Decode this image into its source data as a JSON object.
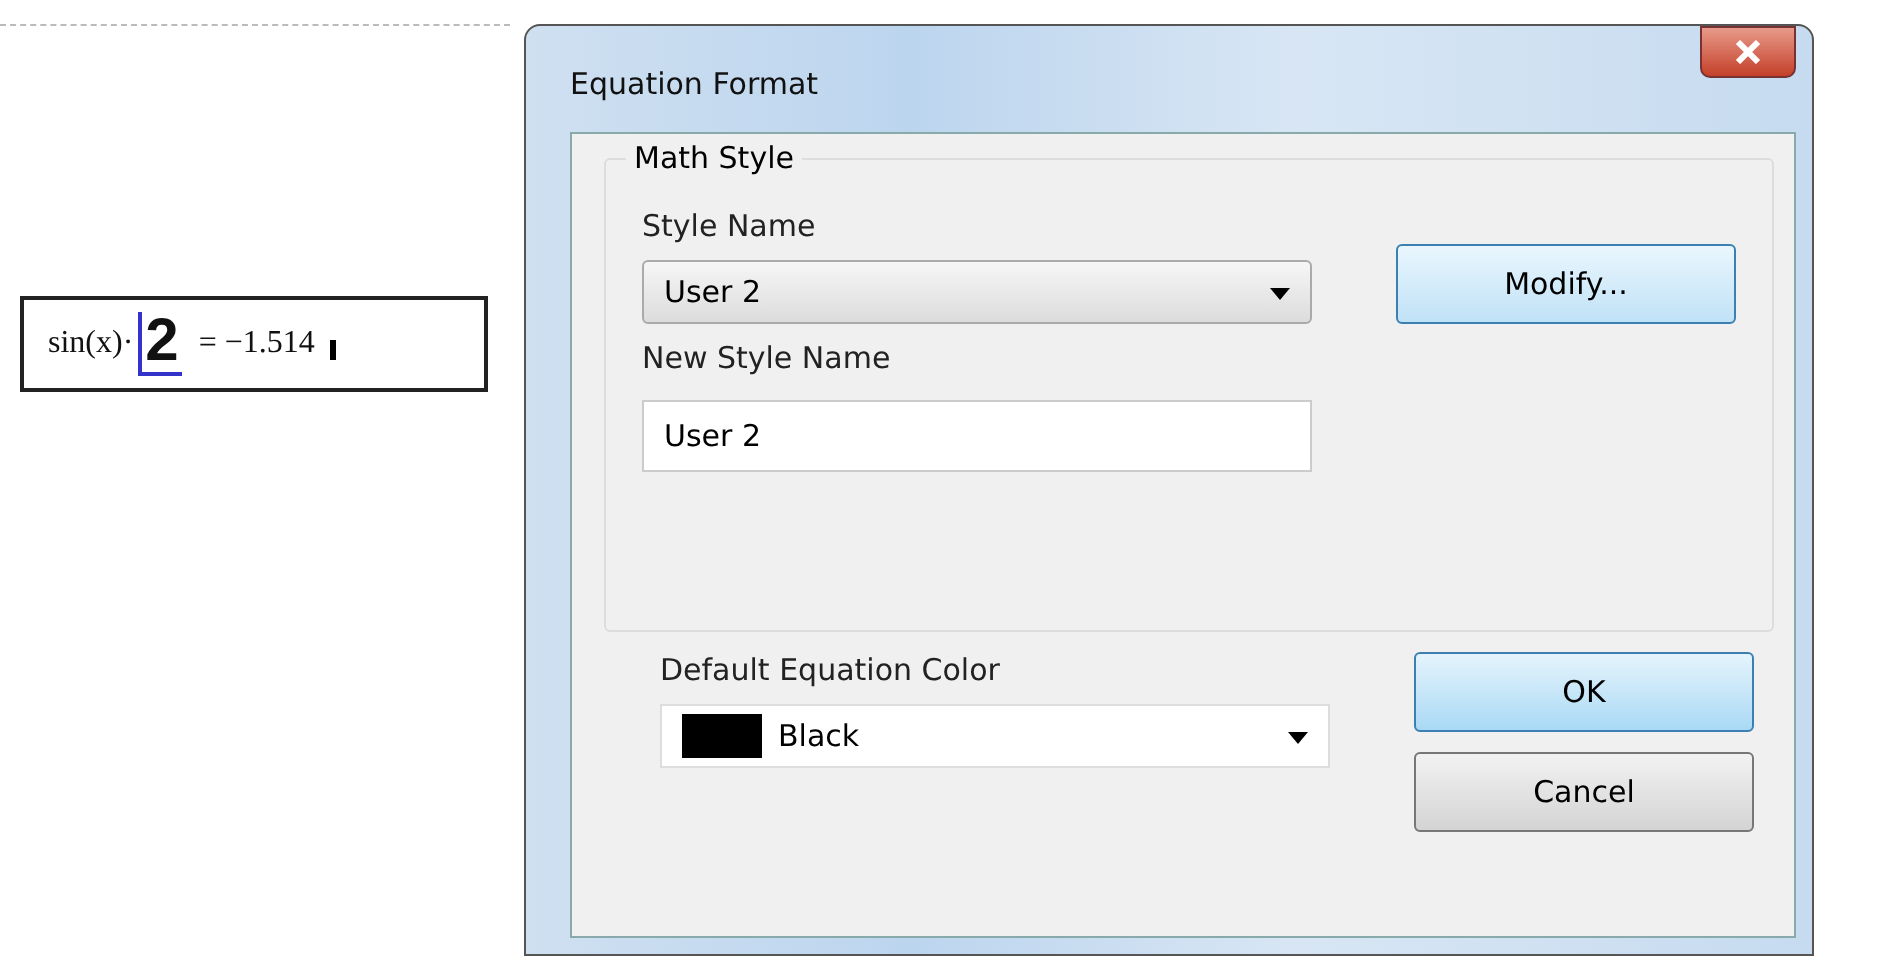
{
  "worksheet": {
    "expression": {
      "left": "sin(x)·",
      "operand": "2",
      "result": "= −1.514"
    }
  },
  "dialog": {
    "title": "Equation Format",
    "math_style": {
      "legend": "Math Style",
      "style_name_label": "Style Name",
      "style_name": "User 2",
      "modify_button": "Modify...",
      "new_style_name_label": "New Style Name",
      "new_style_name": "User 2"
    },
    "color_label": "Default Equation Color",
    "color": {
      "name": "Black",
      "color": "#000000"
    },
    "buttons": [
      {
        "label": "OK",
        "default": true
      },
      {
        "label": "Cancel",
        "default": false
      }
    ]
  }
}
